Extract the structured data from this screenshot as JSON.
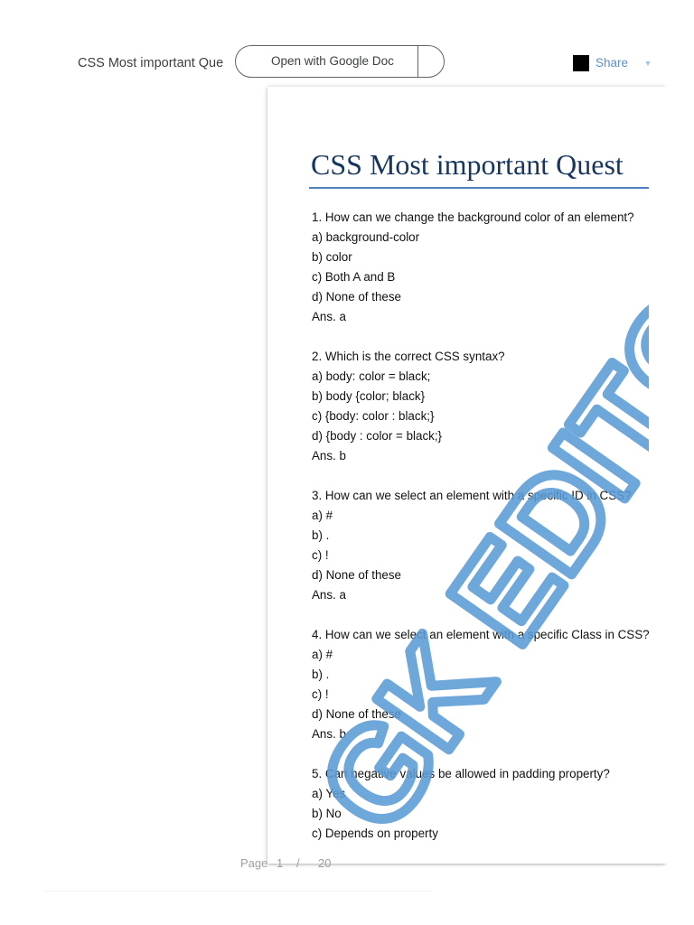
{
  "viewer": {
    "doc_title": "CSS Most important Que",
    "open_with_label": "Open with Google Doc",
    "share_label": "Share",
    "share_swatch_color": "#000000",
    "accent_color": "#5b8fc8"
  },
  "document": {
    "heading": "CSS Most important Quest",
    "heading_color": "#17365d",
    "watermark_text": "GK EDITO",
    "watermark_color": "#5b9bd5",
    "q1": {
      "question": "1. How can we change the background color of an element?",
      "a": "a) background-color",
      "b": "b) color",
      "c": "c) Both A and B",
      "d": "d) None of these",
      "ans": "Ans. a"
    },
    "q2": {
      "question": "2. Which is the correct CSS syntax?",
      "a": "a) body: color = black;",
      "b": "b) body {color; black}",
      "c": "c) {body: color : black;}",
      "d": "d) {body : color = black;}",
      "ans": "Ans. b"
    },
    "q3": {
      "question": "3. How can we select an element with a specific ID in CSS?",
      "a": "a) #",
      "b": "b) .",
      "c": "c) !",
      "d": "d) None of these",
      "ans": "Ans. a"
    },
    "q4": {
      "question": "4. How can we select an element with a specific Class in CSS?",
      "a": "a) #",
      "b": "b) .",
      "c": "c) !",
      "d": "d) None of these",
      "ans": "Ans. b"
    },
    "q5": {
      "question": "5. Can negative values be allowed in padding property?",
      "a": "a) Yes",
      "b": "b) No",
      "c": "c) Depends on property"
    }
  },
  "pagination": {
    "page_word": "Page",
    "current_page": "1",
    "separator": "/",
    "total_pages": "20"
  }
}
